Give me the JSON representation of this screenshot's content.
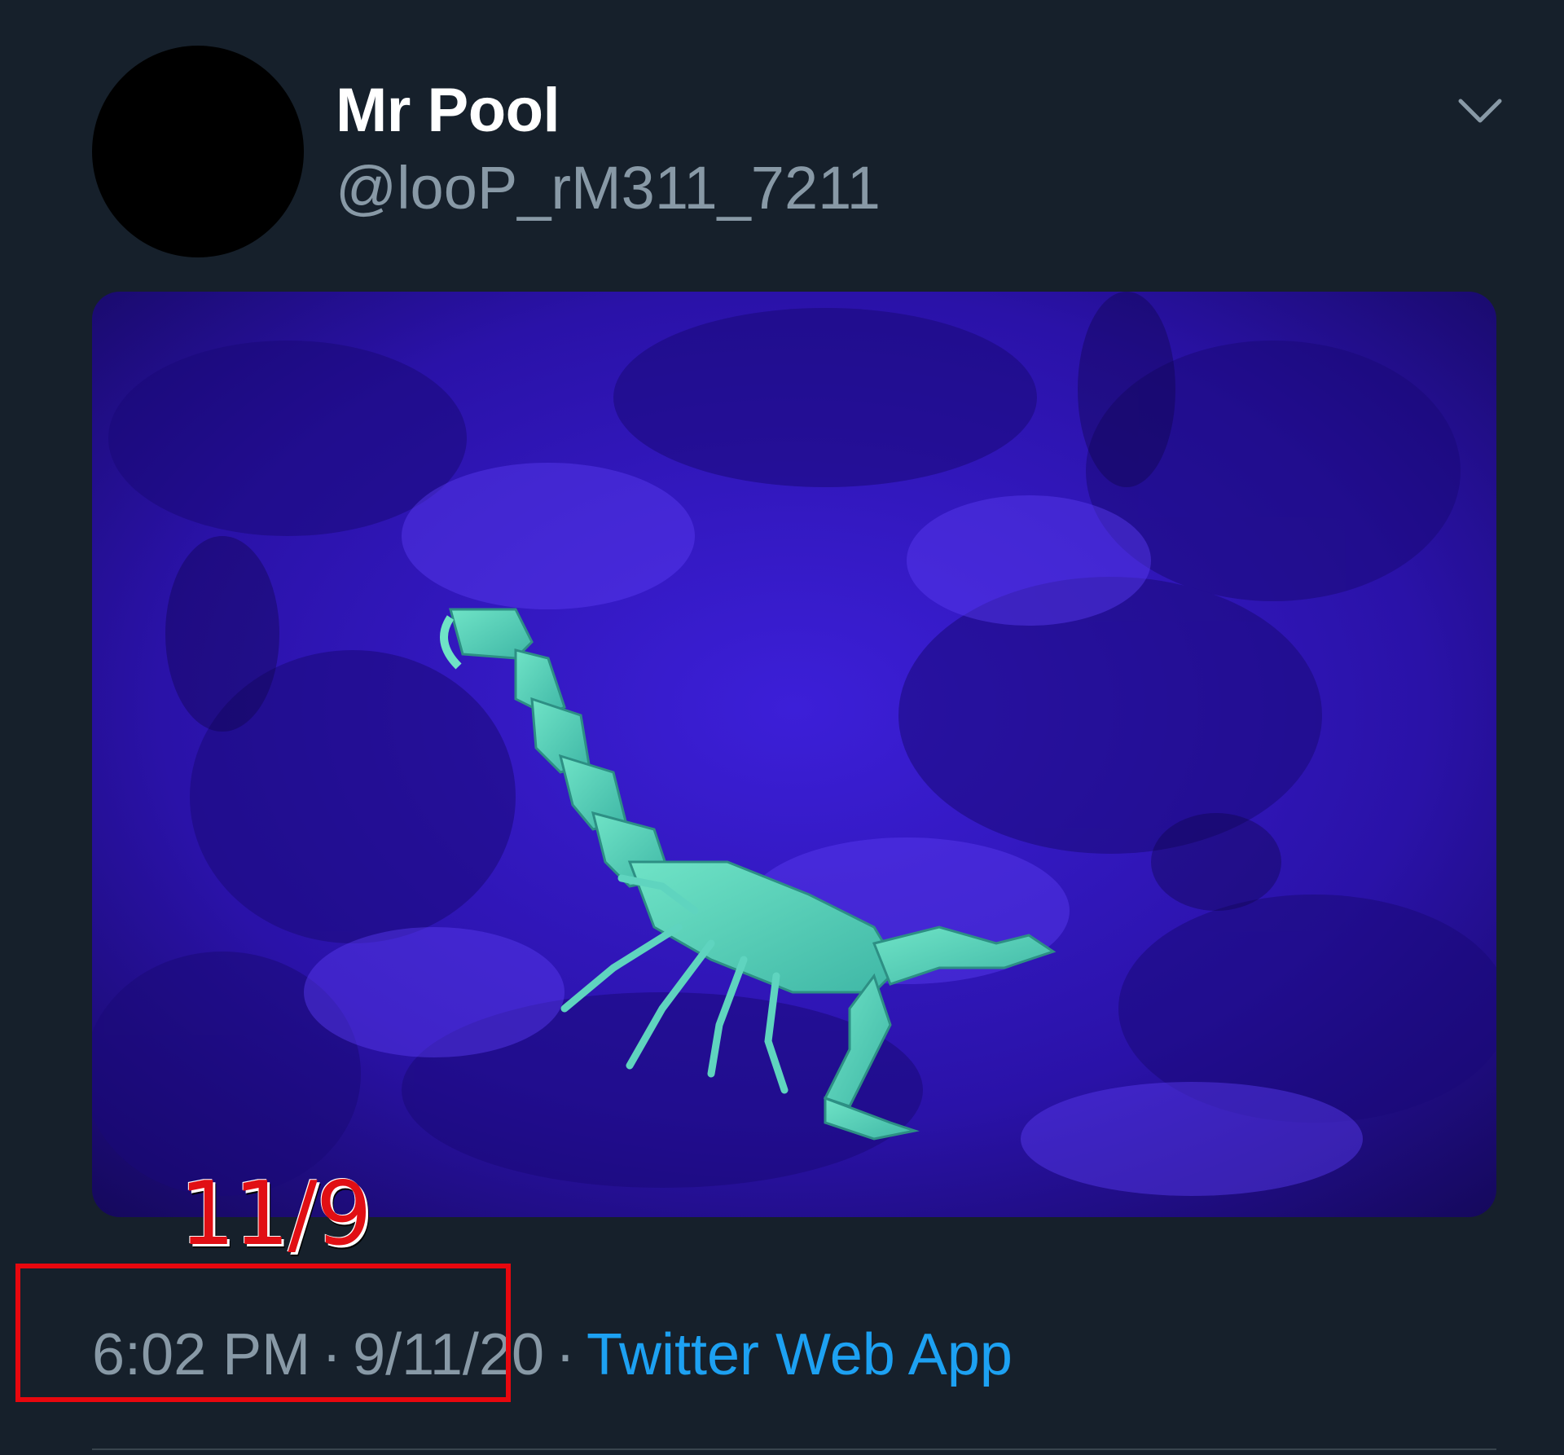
{
  "tweet": {
    "display_name": "Mr Pool",
    "handle": "@looP_rM311_7211",
    "time": "6:02 PM",
    "separator": "·",
    "date": "9/11/20",
    "source": "Twitter Web App",
    "media_description": "scorpion-uv-photo"
  },
  "annotation": {
    "handwritten_text": "11/9",
    "color": "#e10f14"
  },
  "colors": {
    "background": "#16202b",
    "name": "#ffffff",
    "muted": "#8899a6",
    "link": "#1da1f2"
  },
  "icons": {
    "menu": "chevron-down-icon"
  }
}
